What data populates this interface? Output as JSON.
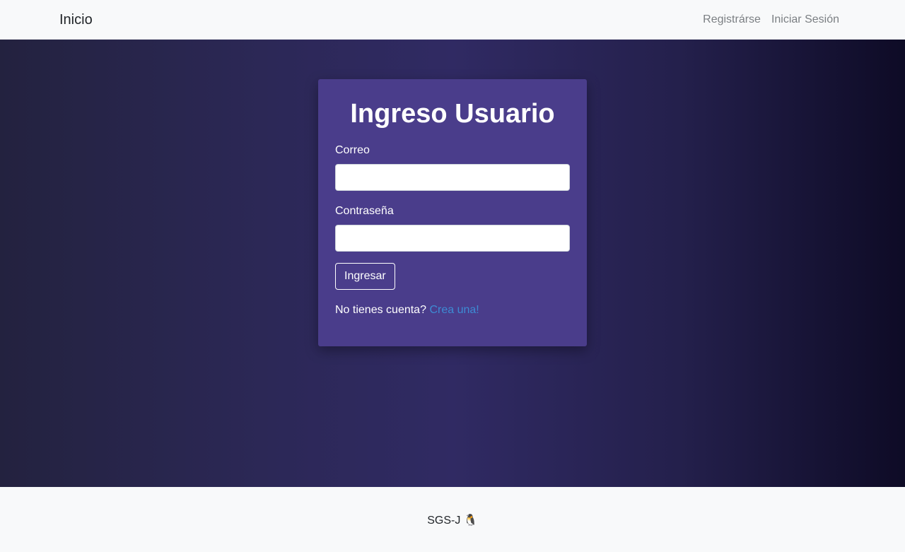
{
  "navbar": {
    "brand": "Inicio",
    "links": [
      {
        "label": "Registrárse"
      },
      {
        "label": "Iniciar Sesión"
      }
    ]
  },
  "login": {
    "title": "Ingreso Usuario",
    "email_label": "Correo",
    "email_value": "",
    "password_label": "Contraseña",
    "password_value": "",
    "submit_label": "Ingresar",
    "signup_prompt": "No tienes cuenta?",
    "signup_link": "Crea una!"
  },
  "footer": {
    "text": "SGS-J 🐧"
  },
  "colors": {
    "card_bg": "#4a3d8b",
    "link": "#3d8bd4",
    "navbar_bg": "#f8f9fa"
  }
}
